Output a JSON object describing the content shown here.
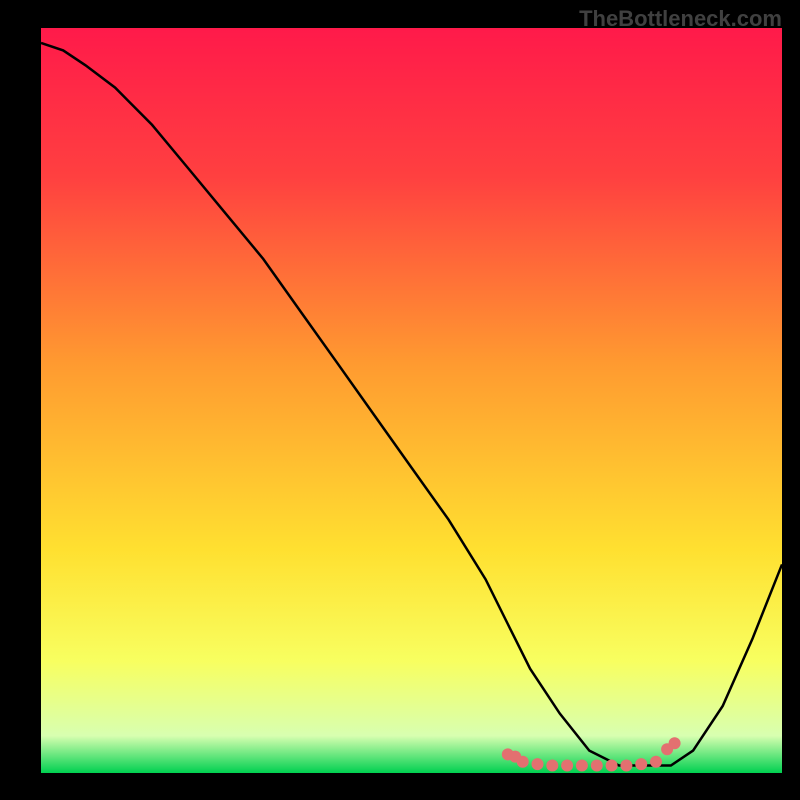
{
  "watermark": "TheBottleneck.com",
  "chart_data": {
    "type": "line",
    "title": "",
    "xlabel": "",
    "ylabel": "",
    "xlim": [
      0,
      100
    ],
    "ylim": [
      0,
      100
    ],
    "gradient_stops": [
      {
        "offset": 0,
        "color": "#ff1a4a"
      },
      {
        "offset": 20,
        "color": "#ff4040"
      },
      {
        "offset": 45,
        "color": "#ff9a30"
      },
      {
        "offset": 70,
        "color": "#ffe030"
      },
      {
        "offset": 85,
        "color": "#f8ff60"
      },
      {
        "offset": 95,
        "color": "#d8ffb0"
      },
      {
        "offset": 100,
        "color": "#00d050"
      }
    ],
    "series": [
      {
        "name": "bottleneck-curve",
        "x": [
          0,
          3,
          6,
          10,
          15,
          20,
          25,
          30,
          35,
          40,
          45,
          50,
          55,
          60,
          63,
          66,
          70,
          74,
          78,
          82,
          85,
          88,
          92,
          96,
          100
        ],
        "y": [
          98,
          97,
          95,
          92,
          87,
          81,
          75,
          69,
          62,
          55,
          48,
          41,
          34,
          26,
          20,
          14,
          8,
          3,
          1,
          1,
          1,
          3,
          9,
          18,
          28
        ]
      }
    ],
    "markers": {
      "name": "optimal-range",
      "color": "#e37070",
      "points": [
        {
          "x": 63,
          "y": 2.5
        },
        {
          "x": 64,
          "y": 2.2
        },
        {
          "x": 65,
          "y": 1.5
        },
        {
          "x": 67,
          "y": 1.2
        },
        {
          "x": 69,
          "y": 1.0
        },
        {
          "x": 71,
          "y": 1.0
        },
        {
          "x": 73,
          "y": 1.0
        },
        {
          "x": 75,
          "y": 1.0
        },
        {
          "x": 77,
          "y": 1.0
        },
        {
          "x": 79,
          "y": 1.0
        },
        {
          "x": 81,
          "y": 1.2
        },
        {
          "x": 83,
          "y": 1.5
        },
        {
          "x": 84.5,
          "y": 3.2
        },
        {
          "x": 85.5,
          "y": 4.0
        }
      ]
    }
  }
}
